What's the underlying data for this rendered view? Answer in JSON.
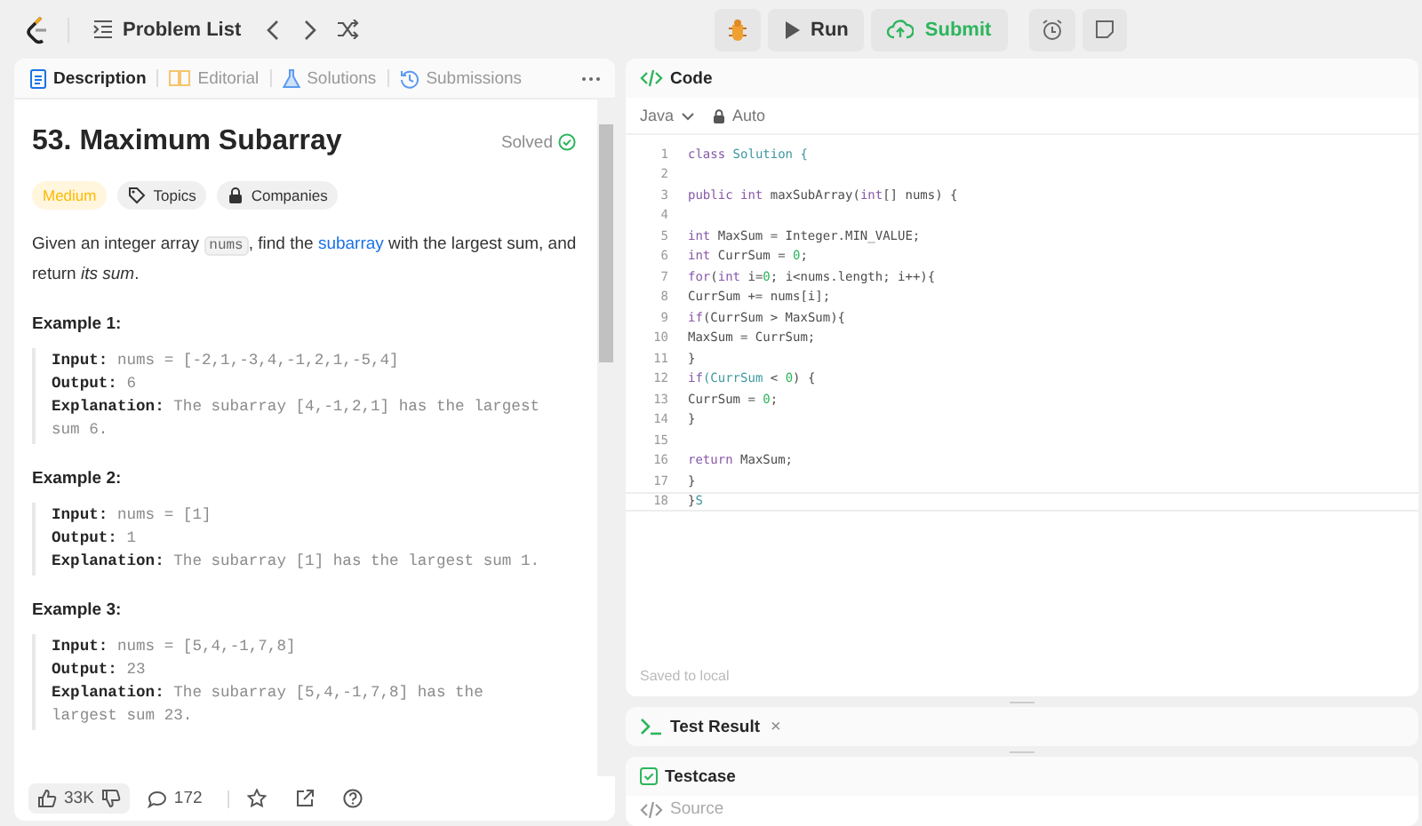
{
  "topbar": {
    "problem_list": "Problem List",
    "run": "Run",
    "submit": "Submit"
  },
  "description": {
    "tabs": [
      {
        "label": "Description",
        "selected": true
      },
      {
        "label": "Editorial",
        "selected": false
      },
      {
        "label": "Solutions",
        "selected": false
      },
      {
        "label": "Submissions",
        "selected": false
      }
    ],
    "title": "53. Maximum Subarray",
    "status": "Solved",
    "tags": [
      {
        "label": "Medium",
        "kind": "difficulty",
        "color": "#ffb800"
      },
      {
        "label": "Topics",
        "kind": "topics"
      },
      {
        "label": "Companies",
        "kind": "companies"
      }
    ],
    "statement": [
      {
        "kind": "text",
        "text": "Given an integer array "
      },
      {
        "kind": "code",
        "text": "nums"
      },
      {
        "kind": "text",
        "text": ", find the "
      },
      {
        "kind": "link",
        "text": "subarray"
      },
      {
        "kind": "text",
        "text": " with the largest sum, and return "
      },
      {
        "kind": "italic",
        "text": "its sum"
      },
      {
        "kind": "text",
        "text": "."
      }
    ],
    "examples": [
      {
        "heading": "Example 1:",
        "lines": [
          "**Input:** nums = [-2,1,-3,4,-1,2,1,-5,4]",
          "**Output:** 6",
          "**Explanation:** The subarray [4,-1,2,1] has the largest sum 6."
        ]
      },
      {
        "heading": "Example 2:",
        "lines": [
          "**Input:** nums = [1]",
          "**Output:** 1",
          "**Explanation:** The subarray [1] has the largest sum 1."
        ]
      },
      {
        "heading": "Example 3:",
        "lines": [
          "**Input:** nums = [5,4,-1,7,8]",
          "**Output:** 23",
          "**Explanation:** The subarray [5,4,-1,7,8] has the largest sum 23."
        ]
      }
    ],
    "likes": "33K",
    "comments": "172"
  },
  "code": {
    "title": "Code",
    "language": "Java",
    "mode": "Auto",
    "lines": [
      {
        "no": "1",
        "active": false,
        "tokens": [
          {
            "kind": "keyword",
            "text": "class "
          },
          {
            "kind": "type",
            "text": "Solution {"
          }
        ]
      },
      {
        "no": "2",
        "active": false
      },
      {
        "no": "3",
        "active": false,
        "tokens": [
          {
            "kind": "keyword",
            "text": "public int "
          },
          {
            "kind": "plain",
            "text": "maxSubArray("
          },
          {
            "kind": "keyword",
            "text": "int"
          },
          {
            "kind": "plain",
            "text": "[] nums) {"
          }
        ]
      },
      {
        "no": "4",
        "active": false
      },
      {
        "no": "5",
        "active": false,
        "tokens": [
          {
            "kind": "keyword",
            "text": "int "
          },
          {
            "kind": "plain",
            "text": "MaxSum = Integer.MIN_VALUE;"
          }
        ]
      },
      {
        "no": "6",
        "active": false,
        "tokens": [
          {
            "kind": "keyword",
            "text": "int "
          },
          {
            "kind": "plain",
            "text": "CurrSum = "
          },
          {
            "kind": "number",
            "text": "0"
          },
          {
            "kind": "plain",
            "text": ";"
          }
        ]
      },
      {
        "no": "7",
        "active": false,
        "tokens": [
          {
            "kind": "keyword",
            "text": "for"
          },
          {
            "kind": "plain",
            "text": "("
          },
          {
            "kind": "keyword",
            "text": "int "
          },
          {
            "kind": "plain",
            "text": "i="
          },
          {
            "kind": "number",
            "text": "0"
          },
          {
            "kind": "plain",
            "text": "; i<nums.length; i++){"
          }
        ]
      },
      {
        "no": "8",
        "active": false,
        "tokens": [
          {
            "kind": "plain",
            "text": "CurrSum += nums[i];"
          }
        ]
      },
      {
        "no": "9",
        "active": false,
        "tokens": [
          {
            "kind": "keyword",
            "text": "if"
          },
          {
            "kind": "plain",
            "text": "(CurrSum > MaxSum){"
          }
        ]
      },
      {
        "no": "10",
        "active": false,
        "tokens": [
          {
            "kind": "plain",
            "text": "MaxSum = CurrSum;"
          }
        ]
      },
      {
        "no": "11",
        "active": false,
        "tokens": [
          {
            "kind": "plain",
            "text": "}"
          }
        ]
      },
      {
        "no": "12",
        "active": false,
        "tokens": [
          {
            "kind": "keyword",
            "text": "if"
          },
          {
            "kind": "type",
            "text": "(CurrSum"
          },
          {
            "kind": "plain",
            "text": " < "
          },
          {
            "kind": "number",
            "text": "0"
          },
          {
            "kind": "plain",
            "text": ") {"
          }
        ]
      },
      {
        "no": "13",
        "active": false,
        "tokens": [
          {
            "kind": "plain",
            "text": "CurrSum = "
          },
          {
            "kind": "number",
            "text": "0"
          },
          {
            "kind": "plain",
            "text": ";"
          }
        ]
      },
      {
        "no": "14",
        "active": false,
        "tokens": [
          {
            "kind": "plain",
            "text": "}"
          }
        ]
      },
      {
        "no": "15",
        "active": false
      },
      {
        "no": "16",
        "active": false,
        "tokens": [
          {
            "kind": "keyword",
            "text": "return "
          },
          {
            "kind": "plain",
            "text": "MaxSum;"
          }
        ]
      },
      {
        "no": "17",
        "active": false,
        "tokens": [
          {
            "kind": "plain",
            "text": "}"
          }
        ]
      },
      {
        "no": "18",
        "active": true,
        "tokens": [
          {
            "kind": "plain",
            "text": "}"
          },
          {
            "kind": "type",
            "text": "S"
          }
        ]
      }
    ],
    "saved": "Saved to local"
  },
  "test_result": {
    "title": "Test Result",
    "close": "×"
  },
  "testcase": {
    "title": "Testcase",
    "source": "Source"
  }
}
